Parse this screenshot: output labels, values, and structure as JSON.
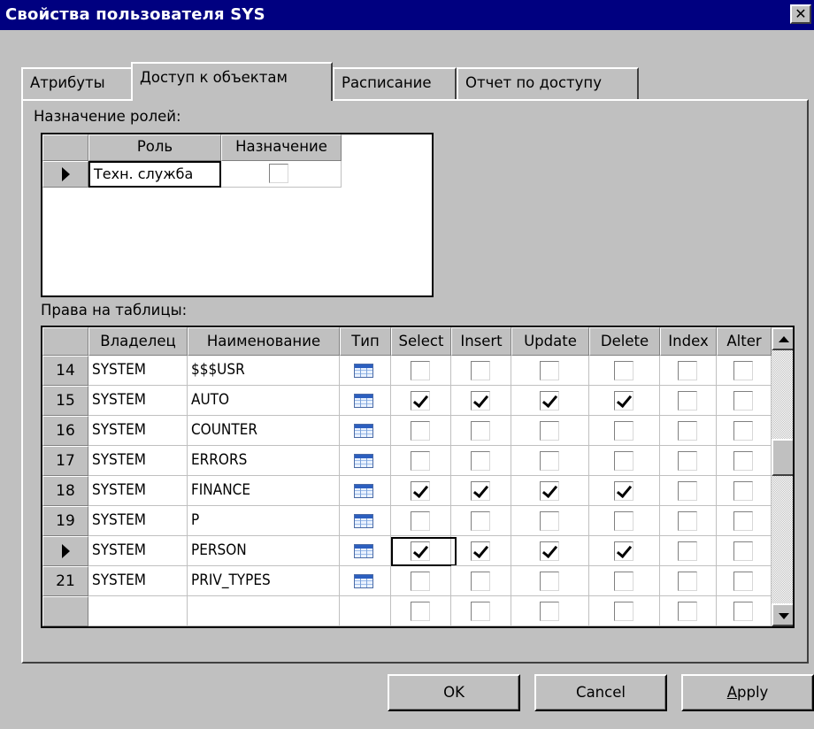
{
  "window": {
    "title": "Свойства пользователя SYS",
    "close_glyph": "✕"
  },
  "tabs": [
    {
      "label": "Атрибуты",
      "active": false
    },
    {
      "label": "Доступ к объектам",
      "active": true
    },
    {
      "label": "Расписание",
      "active": false
    },
    {
      "label": "Отчет по доступу",
      "active": false
    }
  ],
  "roles": {
    "section_label": "Назначение ролей:",
    "columns": [
      "Роль",
      "Назначение"
    ],
    "rows": [
      {
        "role": "Техн. служба",
        "assigned": false
      }
    ]
  },
  "privileges": {
    "section_label": "Права на таблицы:",
    "columns": [
      "Владелец",
      "Наименование",
      "Тип",
      "Select",
      "Insert",
      "Update",
      "Delete",
      "Index",
      "Alter"
    ],
    "rows": [
      {
        "num": "14",
        "owner": "SYSTEM",
        "name": "$$$USR",
        "type_icon": "table-icon",
        "select": false,
        "insert": false,
        "update": false,
        "delete": false,
        "index": false,
        "alter": false
      },
      {
        "num": "15",
        "owner": "SYSTEM",
        "name": "AUTO",
        "type_icon": "table-icon",
        "select": true,
        "insert": true,
        "update": true,
        "delete": true,
        "index": false,
        "alter": false
      },
      {
        "num": "16",
        "owner": "SYSTEM",
        "name": "COUNTER",
        "type_icon": "table-icon",
        "select": false,
        "insert": false,
        "update": false,
        "delete": false,
        "index": false,
        "alter": false
      },
      {
        "num": "17",
        "owner": "SYSTEM",
        "name": "ERRORS",
        "type_icon": "table-icon",
        "select": false,
        "insert": false,
        "update": false,
        "delete": false,
        "index": false,
        "alter": false
      },
      {
        "num": "18",
        "owner": "SYSTEM",
        "name": "FINANCE",
        "type_icon": "table-icon",
        "select": true,
        "insert": true,
        "update": true,
        "delete": true,
        "index": false,
        "alter": false
      },
      {
        "num": "19",
        "owner": "SYSTEM",
        "name": "P",
        "type_icon": "table-icon",
        "select": false,
        "insert": false,
        "update": false,
        "delete": false,
        "index": false,
        "alter": false
      },
      {
        "num": "",
        "current": true,
        "owner": "SYSTEM",
        "name": "PERSON",
        "type_icon": "table-icon",
        "select": true,
        "insert": true,
        "update": true,
        "delete": true,
        "index": false,
        "alter": false
      },
      {
        "num": "21",
        "owner": "SYSTEM",
        "name": "PRIV_TYPES",
        "type_icon": "table-icon",
        "select": false,
        "insert": false,
        "update": false,
        "delete": false,
        "index": false,
        "alter": false
      }
    ]
  },
  "buttons": {
    "ok": "OK",
    "cancel": "Cancel",
    "apply": "Apply"
  }
}
